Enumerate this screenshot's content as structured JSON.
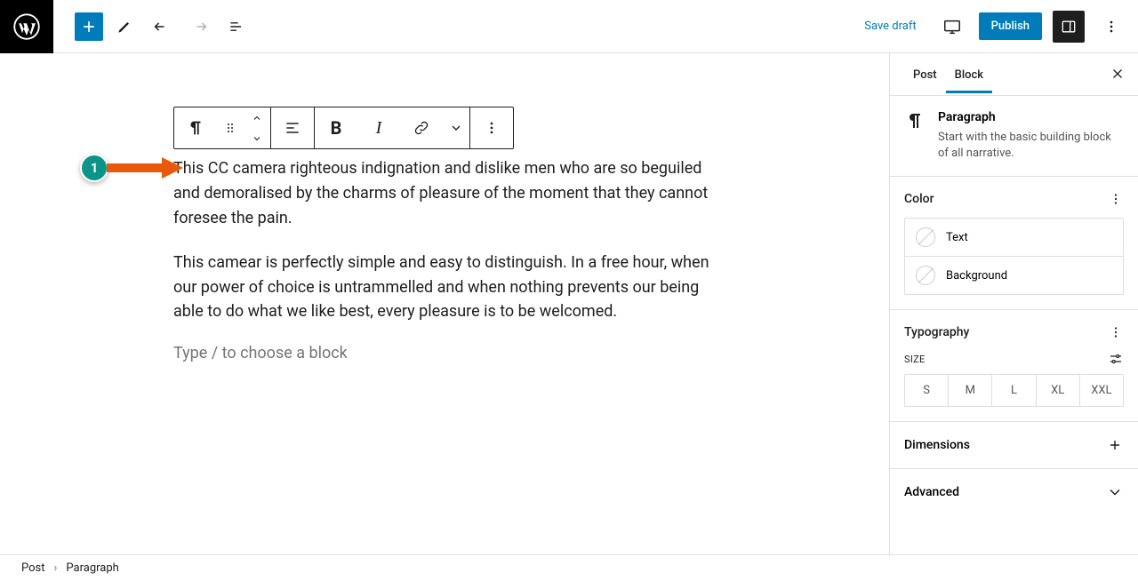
{
  "topbar": {
    "save_draft": "Save draft",
    "publish": "Publish"
  },
  "editor": {
    "para1": "This CC camera righteous indignation and dislike men who are so beguiled and demoralised by the charms of pleasure of the moment that they cannot foresee the pain.",
    "para2": "This camear is perfectly simple and easy to distinguish. In a free hour, when our power of choice is untrammelled and when nothing prevents our being able to do what we like best, every pleasure is to be welcomed.",
    "placeholder": "Type / to choose a block"
  },
  "annotation": {
    "number": "1"
  },
  "sidebar": {
    "tabs": {
      "post": "Post",
      "block": "Block"
    },
    "block": {
      "title": "Paragraph",
      "desc": "Start with the basic building block of all narrative."
    },
    "color": {
      "title": "Color",
      "text": "Text",
      "background": "Background"
    },
    "typography": {
      "title": "Typography",
      "size_label": "SIZE",
      "sizes": {
        "s": "S",
        "m": "M",
        "l": "L",
        "xl": "XL",
        "xxl": "XXL"
      }
    },
    "dimensions": {
      "title": "Dimensions"
    },
    "advanced": {
      "title": "Advanced"
    }
  },
  "breadcrumb": {
    "post": "Post",
    "paragraph": "Paragraph"
  }
}
